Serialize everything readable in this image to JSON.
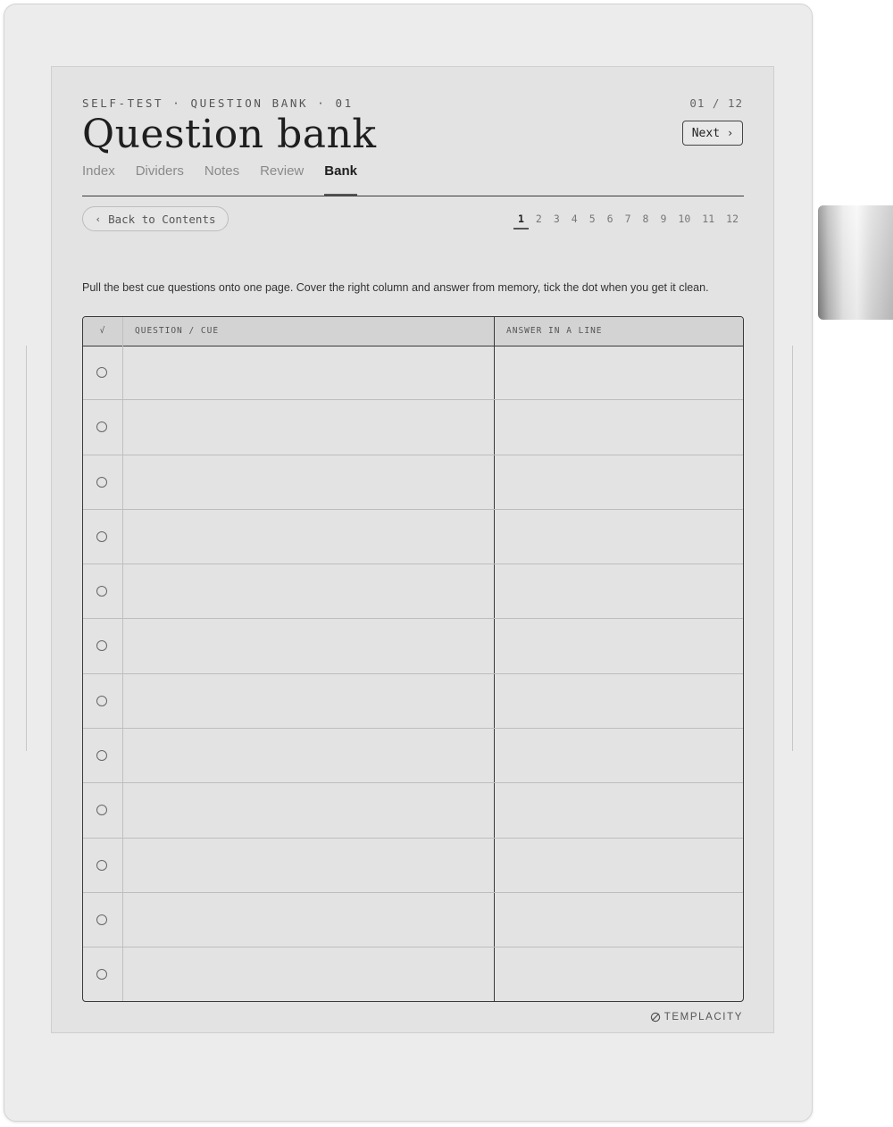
{
  "header": {
    "eyebrow": "SELF-TEST · QUESTION BANK · 01",
    "title": "Question bank",
    "page_counter": "01 / 12",
    "next_label": "Next",
    "next_chevron": "›"
  },
  "tabs": [
    {
      "label": "Index",
      "active": false
    },
    {
      "label": "Dividers",
      "active": false
    },
    {
      "label": "Notes",
      "active": false
    },
    {
      "label": "Review",
      "active": false
    },
    {
      "label": "Bank",
      "active": true
    }
  ],
  "back": {
    "chevron": "‹",
    "label": "Back to Contents"
  },
  "pager": {
    "current": 1,
    "pages": [
      "1",
      "2",
      "3",
      "4",
      "5",
      "6",
      "7",
      "8",
      "9",
      "10",
      "11",
      "12"
    ]
  },
  "instruction": "Pull the best cue questions onto one page. Cover the right column and answer from memory, tick the dot when you get it clean.",
  "table": {
    "headers": {
      "check": "√",
      "question": "QUESTION / CUE",
      "answer": "ANSWER IN A LINE"
    },
    "rows": [
      {
        "question": "",
        "answer": "",
        "done": false
      },
      {
        "question": "",
        "answer": "",
        "done": false
      },
      {
        "question": "",
        "answer": "",
        "done": false
      },
      {
        "question": "",
        "answer": "",
        "done": false
      },
      {
        "question": "",
        "answer": "",
        "done": false
      },
      {
        "question": "",
        "answer": "",
        "done": false
      },
      {
        "question": "",
        "answer": "",
        "done": false
      },
      {
        "question": "",
        "answer": "",
        "done": false
      },
      {
        "question": "",
        "answer": "",
        "done": false
      },
      {
        "question": "",
        "answer": "",
        "done": false
      },
      {
        "question": "",
        "answer": "",
        "done": false
      },
      {
        "question": "",
        "answer": "",
        "done": false
      }
    ]
  },
  "brand": {
    "name": "TEMPLACITY",
    "icon": "templacity-logo-icon"
  }
}
